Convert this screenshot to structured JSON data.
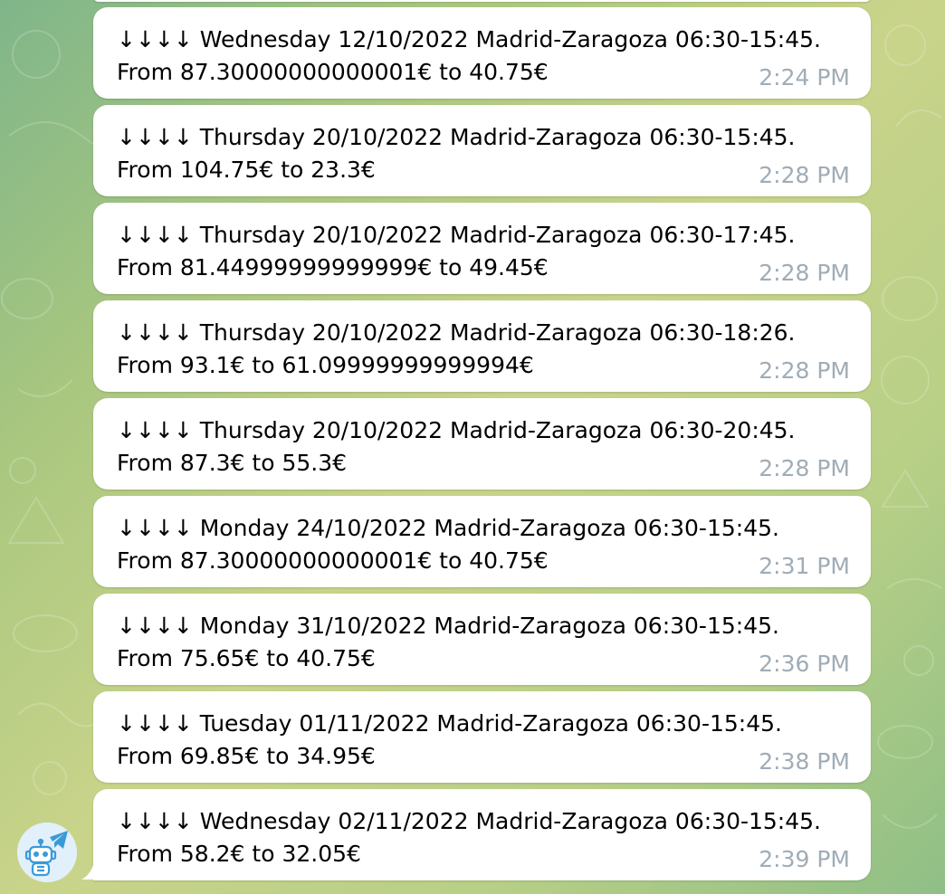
{
  "chat": {
    "messages": [
      {
        "text": "↓↓↓↓ Wednesday 12/10/2022 Madrid-Zaragoza 06:30-15:45. From 87.30000000000001€ to 40.75€",
        "time": "2:24 PM"
      },
      {
        "text": "↓↓↓↓ Thursday 20/10/2022 Madrid-Zaragoza 06:30-15:45. From 104.75€ to 23.3€",
        "time": "2:28 PM"
      },
      {
        "text": "↓↓↓↓ Thursday 20/10/2022 Madrid-Zaragoza 06:30-17:45. From 81.44999999999999€ to 49.45€",
        "time": "2:28 PM"
      },
      {
        "text": "↓↓↓↓ Thursday 20/10/2022 Madrid-Zaragoza 06:30-18:26. From 93.1€ to 61.09999999999994€",
        "time": "2:28 PM"
      },
      {
        "text": "↓↓↓↓ Thursday 20/10/2022 Madrid-Zaragoza 06:30-20:45. From 87.3€ to 55.3€",
        "time": "2:28 PM"
      },
      {
        "text": "↓↓↓↓ Monday 24/10/2022 Madrid-Zaragoza 06:30-15:45. From 87.30000000000001€ to 40.75€",
        "time": "2:31 PM"
      },
      {
        "text": "↓↓↓↓ Monday 31/10/2022 Madrid-Zaragoza 06:30-15:45. From 75.65€ to 40.75€",
        "time": "2:36 PM"
      },
      {
        "text": "↓↓↓↓ Tuesday 01/11/2022 Madrid-Zaragoza 06:30-15:45. From 69.85€ to 34.95€",
        "time": "2:38 PM"
      },
      {
        "text": "↓↓↓↓ Wednesday 02/11/2022 Madrid-Zaragoza 06:30-15:45. From 58.2€ to 32.05€",
        "time": "2:39 PM"
      }
    ]
  },
  "bot_avatar": {
    "icon": "robot-telegram-icon"
  },
  "colors": {
    "bubble_bg": "#ffffff",
    "timestamp": "#a0acb6",
    "wallpaper_start": "#7fb58a",
    "wallpaper_end": "#8fbf86"
  }
}
